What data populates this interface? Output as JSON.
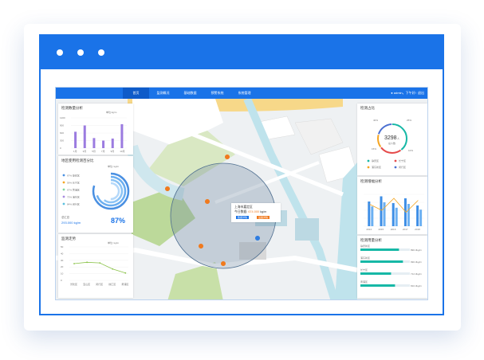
{
  "topbar": {
    "nav": [
      "首页",
      "监测概况",
      "基础数据",
      "预警系统",
      "系统管理"
    ],
    "user": "admin，下午好!",
    "logout": "退出"
  },
  "left1": {
    "title": "检测数量分析",
    "unit": "单位:kg/m",
    "yticks": [
      "1200",
      "900",
      "600",
      "300",
      "0"
    ],
    "xlabels": [
      "1月",
      "3月",
      "5月",
      "7月",
      "9月",
      "10月"
    ],
    "values": [
      650,
      900,
      400,
      300,
      380,
      950
    ],
    "ymax": 1200
  },
  "left2": {
    "title": "地区使用检测百分比",
    "unit": "单位: kg/m",
    "legend": [
      {
        "label": "67% 静安区",
        "color": "#4a90e2"
      },
      {
        "label": "59% 长宁区",
        "color": "#f5a623"
      },
      {
        "label": "67% 黄浦区",
        "color": "#7ed6a0"
      },
      {
        "label": "73% 浦东区",
        "color": "#a88be0"
      },
      {
        "label": "84% 闵行区",
        "color": "#5bc0de"
      }
    ],
    "total_label": "总汇总",
    "total_value": "293.000",
    "total_unit": "kg/m",
    "percent": "87%"
  },
  "left3": {
    "title": "监测走势",
    "unit": "单位: kg/m",
    "yticks": [
      "50",
      "40",
      "30",
      "20",
      "10",
      "0"
    ],
    "xlabels": [
      "普陀区",
      "宝山区",
      "闵行区",
      "徐汇区",
      "黄浦区"
    ],
    "values": [
      25,
      27,
      26,
      17,
      11
    ],
    "ymax": 50
  },
  "map": {
    "popup_title": "上海市嘉定区",
    "popup_label": "今日数据:",
    "popup_value": "674.000",
    "popup_unit": "kg/m",
    "btn1": "数据详情",
    "btn2": "设备详情"
  },
  "right1": {
    "title": "检测占比",
    "center_value": "3298",
    "center_unit": "人",
    "center_label": "总人数",
    "pct_top": "40%",
    "pct_right": "25%",
    "pct_left": "15%",
    "pct_bottom": "10%",
    "legend": [
      {
        "label": "静安区",
        "color": "#17b8a6"
      },
      {
        "label": "长宁区",
        "color": "#e54b4b"
      },
      {
        "label": "浦东新区",
        "color": "#f5a623"
      },
      {
        "label": "闵行区",
        "color": "#4a6fd1"
      }
    ]
  },
  "right2": {
    "title": "检测增幅分析",
    "xlabels": [
      "2014",
      "2015",
      "2016",
      "2017",
      "2018"
    ],
    "values": [
      62,
      75,
      58,
      70,
      52
    ],
    "line": [
      55,
      40,
      70,
      35,
      65
    ]
  },
  "right3": {
    "title": "检测用量分析",
    "rows": [
      {
        "label": "静安新区",
        "value": "890.3kg/m",
        "fill": 0.78,
        "color": "#17b8a6"
      },
      {
        "label": "浦东新区",
        "value": "990.3kg/m",
        "fill": 0.86,
        "color": "#17b8a6"
      },
      {
        "label": "长宁区",
        "value": "712.3kg/m",
        "fill": 0.62,
        "color": "#17b8a6"
      },
      {
        "label": "黄浦区",
        "value": "810.3kg/m",
        "fill": 0.7,
        "color": "#17b8a6"
      }
    ]
  }
}
